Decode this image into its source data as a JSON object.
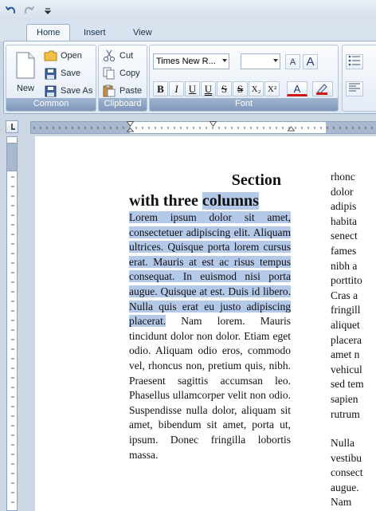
{
  "tabs": [
    {
      "label": "Home",
      "active": true
    },
    {
      "label": "Insert",
      "active": false
    },
    {
      "label": "View",
      "active": false
    }
  ],
  "ribbon": {
    "common": {
      "label": "Common",
      "new_label": "New",
      "open_label": "Open",
      "save_label": "Save",
      "saveas_label": "Save As"
    },
    "clipboard": {
      "label": "Clipboard",
      "cut_label": "Cut",
      "copy_label": "Copy",
      "paste_label": "Paste"
    },
    "font": {
      "label": "Font",
      "font_name": "Times New R...",
      "font_size": "",
      "bold": "B",
      "italic": "I",
      "underline": "U",
      "double_underline": "U",
      "strike": "S",
      "double_strike": "S",
      "subscript": "X₂",
      "superscript": "X²",
      "grow": "A",
      "shrink": "A",
      "font_color": "A"
    }
  },
  "document": {
    "heading_line1": "Section",
    "heading_line2_plain": "with three ",
    "heading_line2_hl": "columns",
    "col1_hl": "Lorem ipsum dolor sit amet, consectetuer adipiscing elit. Aliquam ultrices. Quisque porta lorem cursus erat. Mauris at est ac risus tempus consequat. In euismod nisi porta augue. Quisque at est. Duis id libero. Nulla quis erat eu justo adipiscing placerat.",
    "col1_plain": " Nam lorem. Mauris tincidunt dolor non dolor. Etiam eget odio. Aliquam odio eros, commodo vel, rhoncus non, pretium quis, nibh. Praesent sagittis accumsan leo. Phasellus ullamcorper velit non odio. Suspendisse nulla dolor, aliquam sit amet, bibendum sit amet, porta ut, ipsum. Donec fringilla lobortis massa.",
    "col2_lines_a": [
      "rhonc",
      "dolor",
      "adipis",
      "habita",
      "senect",
      "fames",
      "nibh a",
      "porttito",
      "Cras a",
      "fringill",
      "aliquet",
      "placera",
      "amet n",
      "vehicul",
      "sed tem",
      "sapien",
      "rutrum"
    ],
    "col2_lines_b": [
      "Nulla",
      "vestibu",
      "consect",
      "augue.",
      "Nam"
    ]
  },
  "colors": {
    "selection": "#b4c8e8",
    "ribbon_label_bg": "#8aa2c2"
  }
}
